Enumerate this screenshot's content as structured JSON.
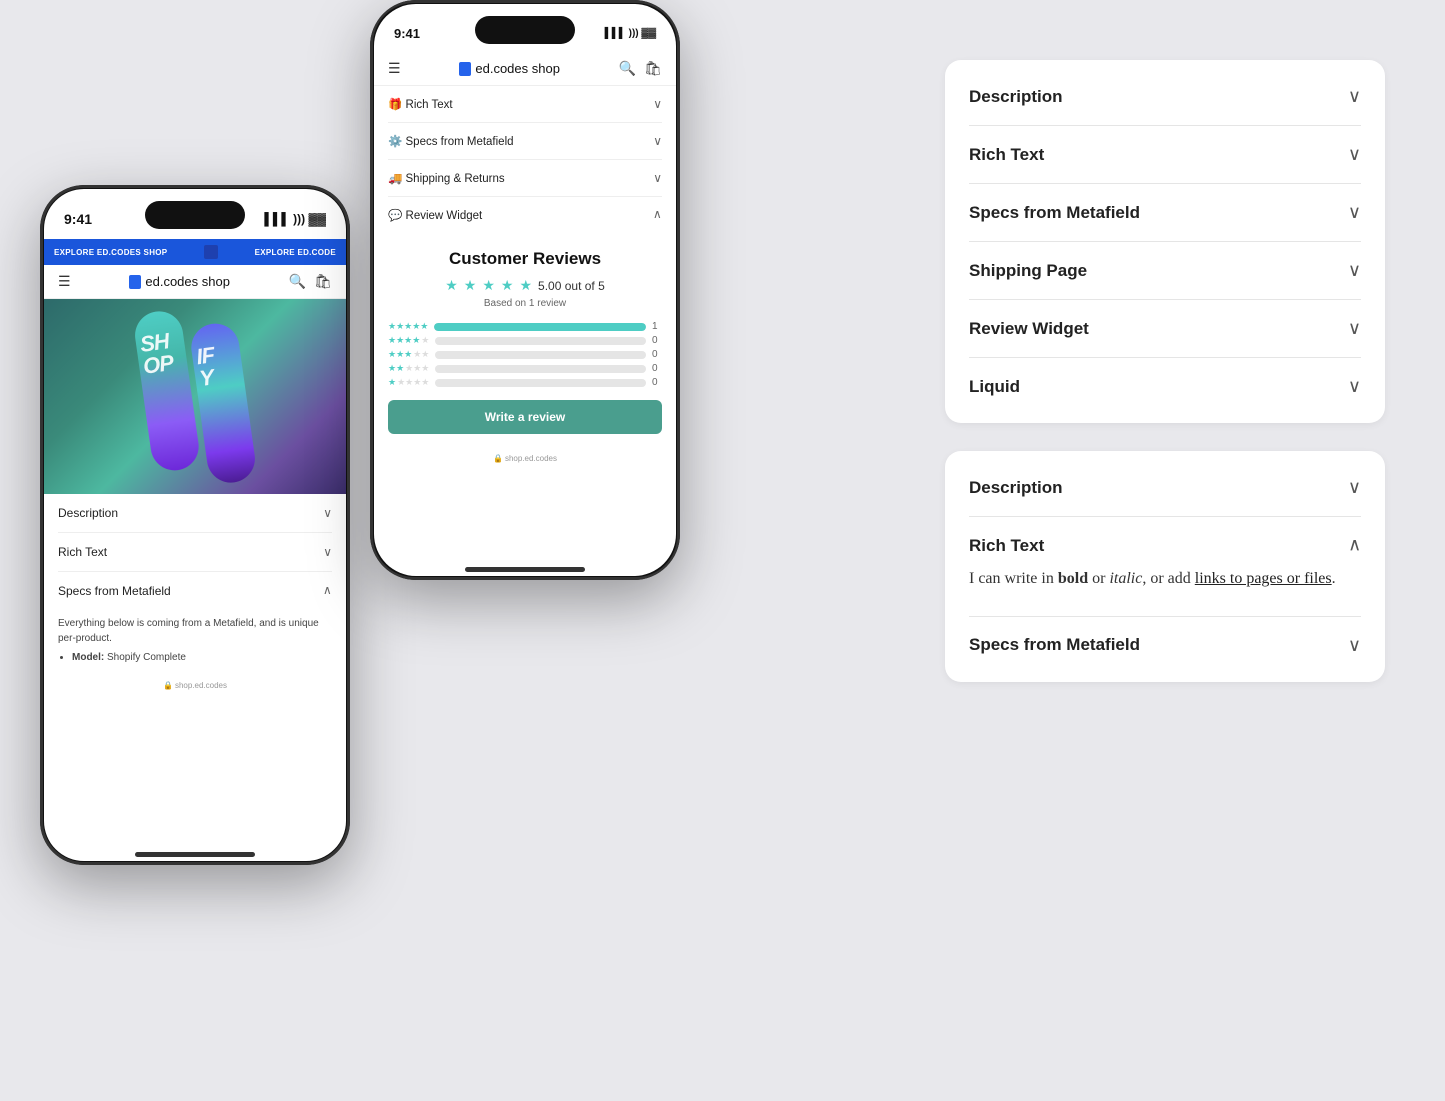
{
  "app": {
    "title": "ed.codes shop",
    "logo_text": "ed.codes",
    "logo_suffix": " shop"
  },
  "phone_left": {
    "status_time": "9:41",
    "explore_bar_left": "EXPLORE ED.CODES SHOP",
    "explore_bar_right": "EXPLORE ED.CODE",
    "logo_text": "ed.codes",
    "logo_suffix": " shop",
    "accordion": [
      {
        "label": "Description",
        "open": false
      },
      {
        "label": "Rich Text",
        "open": false
      },
      {
        "label": "Specs from Metafield",
        "open": true,
        "body": "Everything below is coming from a Metafield, and is unique per-product.",
        "list": [
          {
            "key": "Model",
            "value": "Shopify Complete"
          }
        ]
      }
    ],
    "footer_url": "shop.ed.codes"
  },
  "phone_center": {
    "store_name": "ed.codes shop",
    "logo_text": "ed.codes",
    "logo_suffix": " shop",
    "accordion": [
      {
        "label": "🎁 Rich Text",
        "open": false
      },
      {
        "label": "⚙️ Specs from Metafield",
        "open": false
      },
      {
        "label": "🚚 Shipping & Returns",
        "open": false
      },
      {
        "label": "💬 Review Widget",
        "open": true
      }
    ],
    "review": {
      "title": "Customer Reviews",
      "score": "5.00 out of 5",
      "based_on": "Based on 1 review",
      "bars": [
        {
          "stars": 5,
          "fill": 100,
          "count": 1
        },
        {
          "stars": 4,
          "fill": 0,
          "count": 0
        },
        {
          "stars": 3,
          "fill": 0,
          "count": 0
        },
        {
          "stars": 2,
          "fill": 0,
          "count": 0
        },
        {
          "stars": 1,
          "fill": 0,
          "count": 0
        }
      ],
      "write_button": "Write a review"
    },
    "footer_url": "shop.ed.codes"
  },
  "right_card_1": {
    "items": [
      {
        "label": "Description"
      },
      {
        "label": "Rich Text"
      },
      {
        "label": "Specs from Metafield"
      },
      {
        "label": "Shipping Page"
      },
      {
        "label": "Review Widget"
      },
      {
        "label": "Liquid"
      }
    ]
  },
  "right_card_2": {
    "items": [
      {
        "label": "Description",
        "open": false
      },
      {
        "label": "Rich Text",
        "open": true,
        "body_text": "I can write in ",
        "body_bold": "bold",
        "body_mid": " or ",
        "body_italic": "italic",
        "body_end": ", or add ",
        "body_link": "links to pages or files",
        "body_period": "."
      },
      {
        "label": "Specs from Metafield",
        "open": false
      }
    ]
  }
}
